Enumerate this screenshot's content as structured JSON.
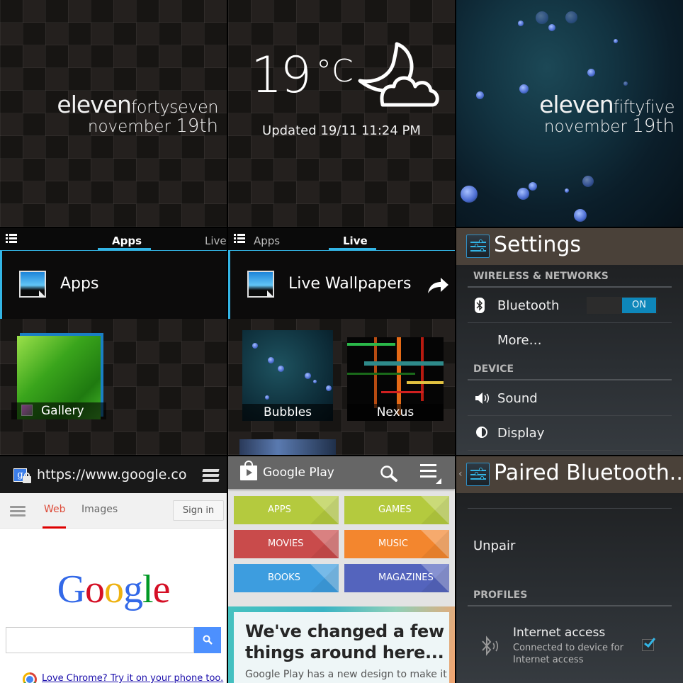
{
  "tiles": {
    "clock1": {
      "hour": "eleven",
      "minutes": "fortyseven",
      "month": "november",
      "day": "19th"
    },
    "weather": {
      "temperature": "19",
      "unit": "°C",
      "condition_icon": "moon-cloud-icon",
      "updated": "Updated 19/11 11:24 PM"
    },
    "clock2": {
      "hour": "eleven",
      "minutes": "fiftyfive",
      "month": "november",
      "day": "19th"
    },
    "apps_drawer": {
      "tabs": [
        {
          "label": "Apps",
          "active": true
        },
        {
          "label": "Live",
          "active": false
        }
      ],
      "header_title": "Apps",
      "items": [
        {
          "label": "Gallery"
        }
      ]
    },
    "live_drawer": {
      "tabs": [
        {
          "label": "Apps",
          "active": false
        },
        {
          "label": "Live",
          "active": true
        }
      ],
      "header_title": "Live Wallpapers",
      "items": [
        {
          "label": "Bubbles"
        },
        {
          "label": "Nexus"
        }
      ]
    },
    "settings": {
      "title": "Settings",
      "sections": [
        {
          "header": "WIRELESS & NETWORKS",
          "items": [
            {
              "label": "Bluetooth",
              "icon": "bluetooth-icon",
              "toggle": "ON"
            },
            {
              "label": "More…"
            }
          ]
        },
        {
          "header": "DEVICE",
          "items": [
            {
              "label": "Sound",
              "icon": "speaker-icon"
            },
            {
              "label": "Display",
              "icon": "brightness-icon"
            }
          ]
        }
      ]
    },
    "chrome": {
      "url": "https://www.google.com/webhp",
      "tabs": [
        {
          "label": "Web",
          "active": true
        },
        {
          "label": "Images",
          "active": false
        }
      ],
      "sign_in": "Sign in",
      "logo_letters": [
        "G",
        "o",
        "o",
        "g",
        "l",
        "e"
      ],
      "logo_colors": [
        "#3369e8",
        "#d50f25",
        "#eeb211",
        "#3369e8",
        "#009925",
        "#d50f25"
      ],
      "search_value": "",
      "promo_link": "Love Chrome? Try it on your phone too."
    },
    "play": {
      "title": "Google Play",
      "categories": [
        {
          "label": "APPS",
          "color": "#b4ca3e"
        },
        {
          "label": "GAMES",
          "color": "#b4ca3e"
        },
        {
          "label": "MOVIES",
          "color": "#c94b4b"
        },
        {
          "label": "MUSIC",
          "color": "#f3862e"
        },
        {
          "label": "BOOKS",
          "color": "#3d9ddf"
        },
        {
          "label": "MAGAZINES",
          "color": "#5464bd"
        }
      ],
      "promo_heading": "We've changed a few things around here...",
      "promo_text": "Google Play has a new design to make it"
    },
    "paired": {
      "title": "Paired Bluetooth...",
      "unpair": "Unpair",
      "profiles_header": "PROFILES",
      "profile_title": "Internet access",
      "profile_summary": "Connected to device for Internet access",
      "profile_checked": true
    }
  }
}
